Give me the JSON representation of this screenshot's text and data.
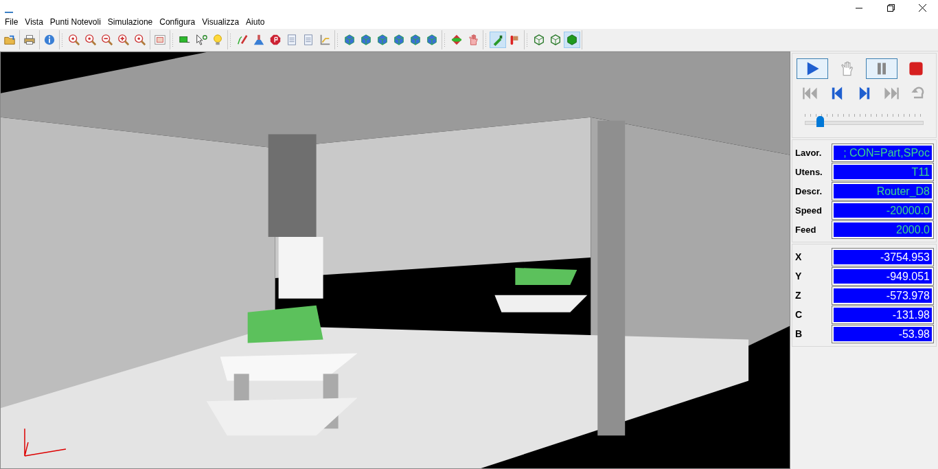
{
  "menu": [
    "File",
    "Vista",
    "Punti Notevoli",
    "Simulazione",
    "Configura",
    "Visualizza",
    "Aiuto"
  ],
  "toolbar": [
    [
      {
        "kind": "open",
        "selected": false
      }
    ],
    [
      {
        "kind": "print",
        "selected": false
      }
    ],
    [
      {
        "kind": "info",
        "selected": false
      }
    ],
    [
      {
        "kind": "zoom",
        "selected": false
      },
      {
        "kind": "zoom",
        "selected": false
      },
      {
        "kind": "zoom-out",
        "selected": false
      },
      {
        "kind": "zoom-in",
        "selected": false
      },
      {
        "kind": "zoom",
        "selected": false
      }
    ],
    [
      {
        "kind": "frame",
        "selected": false
      }
    ],
    [
      {
        "kind": "rect",
        "selected": false
      },
      {
        "kind": "cursor",
        "selected": false
      },
      {
        "kind": "bulb",
        "selected": false
      }
    ],
    [
      {
        "kind": "path",
        "selected": false
      },
      {
        "kind": "tool",
        "selected": false
      },
      {
        "kind": "stop",
        "selected": false
      },
      {
        "kind": "doc",
        "selected": false
      },
      {
        "kind": "doc",
        "selected": false
      },
      {
        "kind": "chart",
        "selected": false
      }
    ],
    [
      {
        "kind": "cube",
        "selected": false
      },
      {
        "kind": "cube",
        "selected": false
      },
      {
        "kind": "cube",
        "selected": false
      },
      {
        "kind": "cube",
        "selected": false
      },
      {
        "kind": "cube",
        "selected": false
      },
      {
        "kind": "cube",
        "selected": false
      }
    ],
    [
      {
        "kind": "axis",
        "selected": false
      },
      {
        "kind": "hand",
        "selected": false
      }
    ],
    [
      {
        "kind": "mill",
        "selected": true
      },
      {
        "kind": "flag",
        "selected": false
      }
    ],
    [
      {
        "kind": "wire",
        "selected": false
      },
      {
        "kind": "wire",
        "selected": false
      },
      {
        "kind": "solid",
        "selected": true
      }
    ]
  ],
  "playback": [
    [
      {
        "kind": "play",
        "selected": true,
        "disabled": false
      },
      {
        "kind": "hand",
        "selected": false,
        "disabled": true
      },
      {
        "kind": "pause",
        "selected": true,
        "disabled": false
      },
      {
        "kind": "stop",
        "selected": false,
        "disabled": false
      }
    ],
    [
      {
        "kind": "first",
        "selected": false,
        "disabled": true
      },
      {
        "kind": "prev",
        "selected": false,
        "disabled": false
      },
      {
        "kind": "next",
        "selected": false,
        "disabled": false
      },
      {
        "kind": "last",
        "selected": false,
        "disabled": true
      },
      {
        "kind": "loop",
        "selected": false,
        "disabled": true
      }
    ]
  ],
  "speed_slider": {
    "level": 0.12
  },
  "info_fields": [
    {
      "label": "Lavor.",
      "value": "; CON=Part,SPoc"
    },
    {
      "label": "Utens.",
      "value": "T11"
    },
    {
      "label": "Descr.",
      "value": "Router_D8"
    },
    {
      "label": "Speed",
      "value": "-20000.0"
    },
    {
      "label": "Feed",
      "value": "2000.0"
    }
  ],
  "axes": [
    {
      "label": "X",
      "value": "-3754.953"
    },
    {
      "label": "Y",
      "value": "-949.051"
    },
    {
      "label": "Z",
      "value": "-573.978"
    },
    {
      "label": "C",
      "value": "-131.98"
    },
    {
      "label": "B",
      "value": "-53.98"
    }
  ]
}
